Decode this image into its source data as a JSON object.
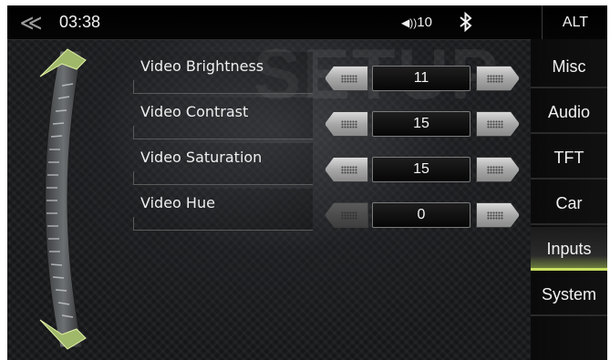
{
  "status_bar": {
    "time": "03:38",
    "volume": "10",
    "alt_label": "ALT",
    "back_icon": "double-chevron-left-icon",
    "speaker_icon": "speaker-icon",
    "bluetooth_icon": "bluetooth-icon"
  },
  "watermark": "SETUP",
  "settings": [
    {
      "label": "Video Brightness",
      "value": "11",
      "dec_enabled": true
    },
    {
      "label": "Video Contrast",
      "value": "15",
      "dec_enabled": true
    },
    {
      "label": "Video Saturation",
      "value": "15",
      "dec_enabled": true
    },
    {
      "label": "Video Hue",
      "value": "0",
      "dec_enabled": false
    }
  ],
  "side_menu": {
    "items": [
      {
        "label": "Misc"
      },
      {
        "label": "Audio"
      },
      {
        "label": "TFT"
      },
      {
        "label": "Car"
      },
      {
        "label": "Inputs"
      },
      {
        "label": "System"
      }
    ],
    "active": "Inputs"
  },
  "colors": {
    "accent": "#c8e060",
    "background": "#151618",
    "text": "#f2f2f2"
  }
}
